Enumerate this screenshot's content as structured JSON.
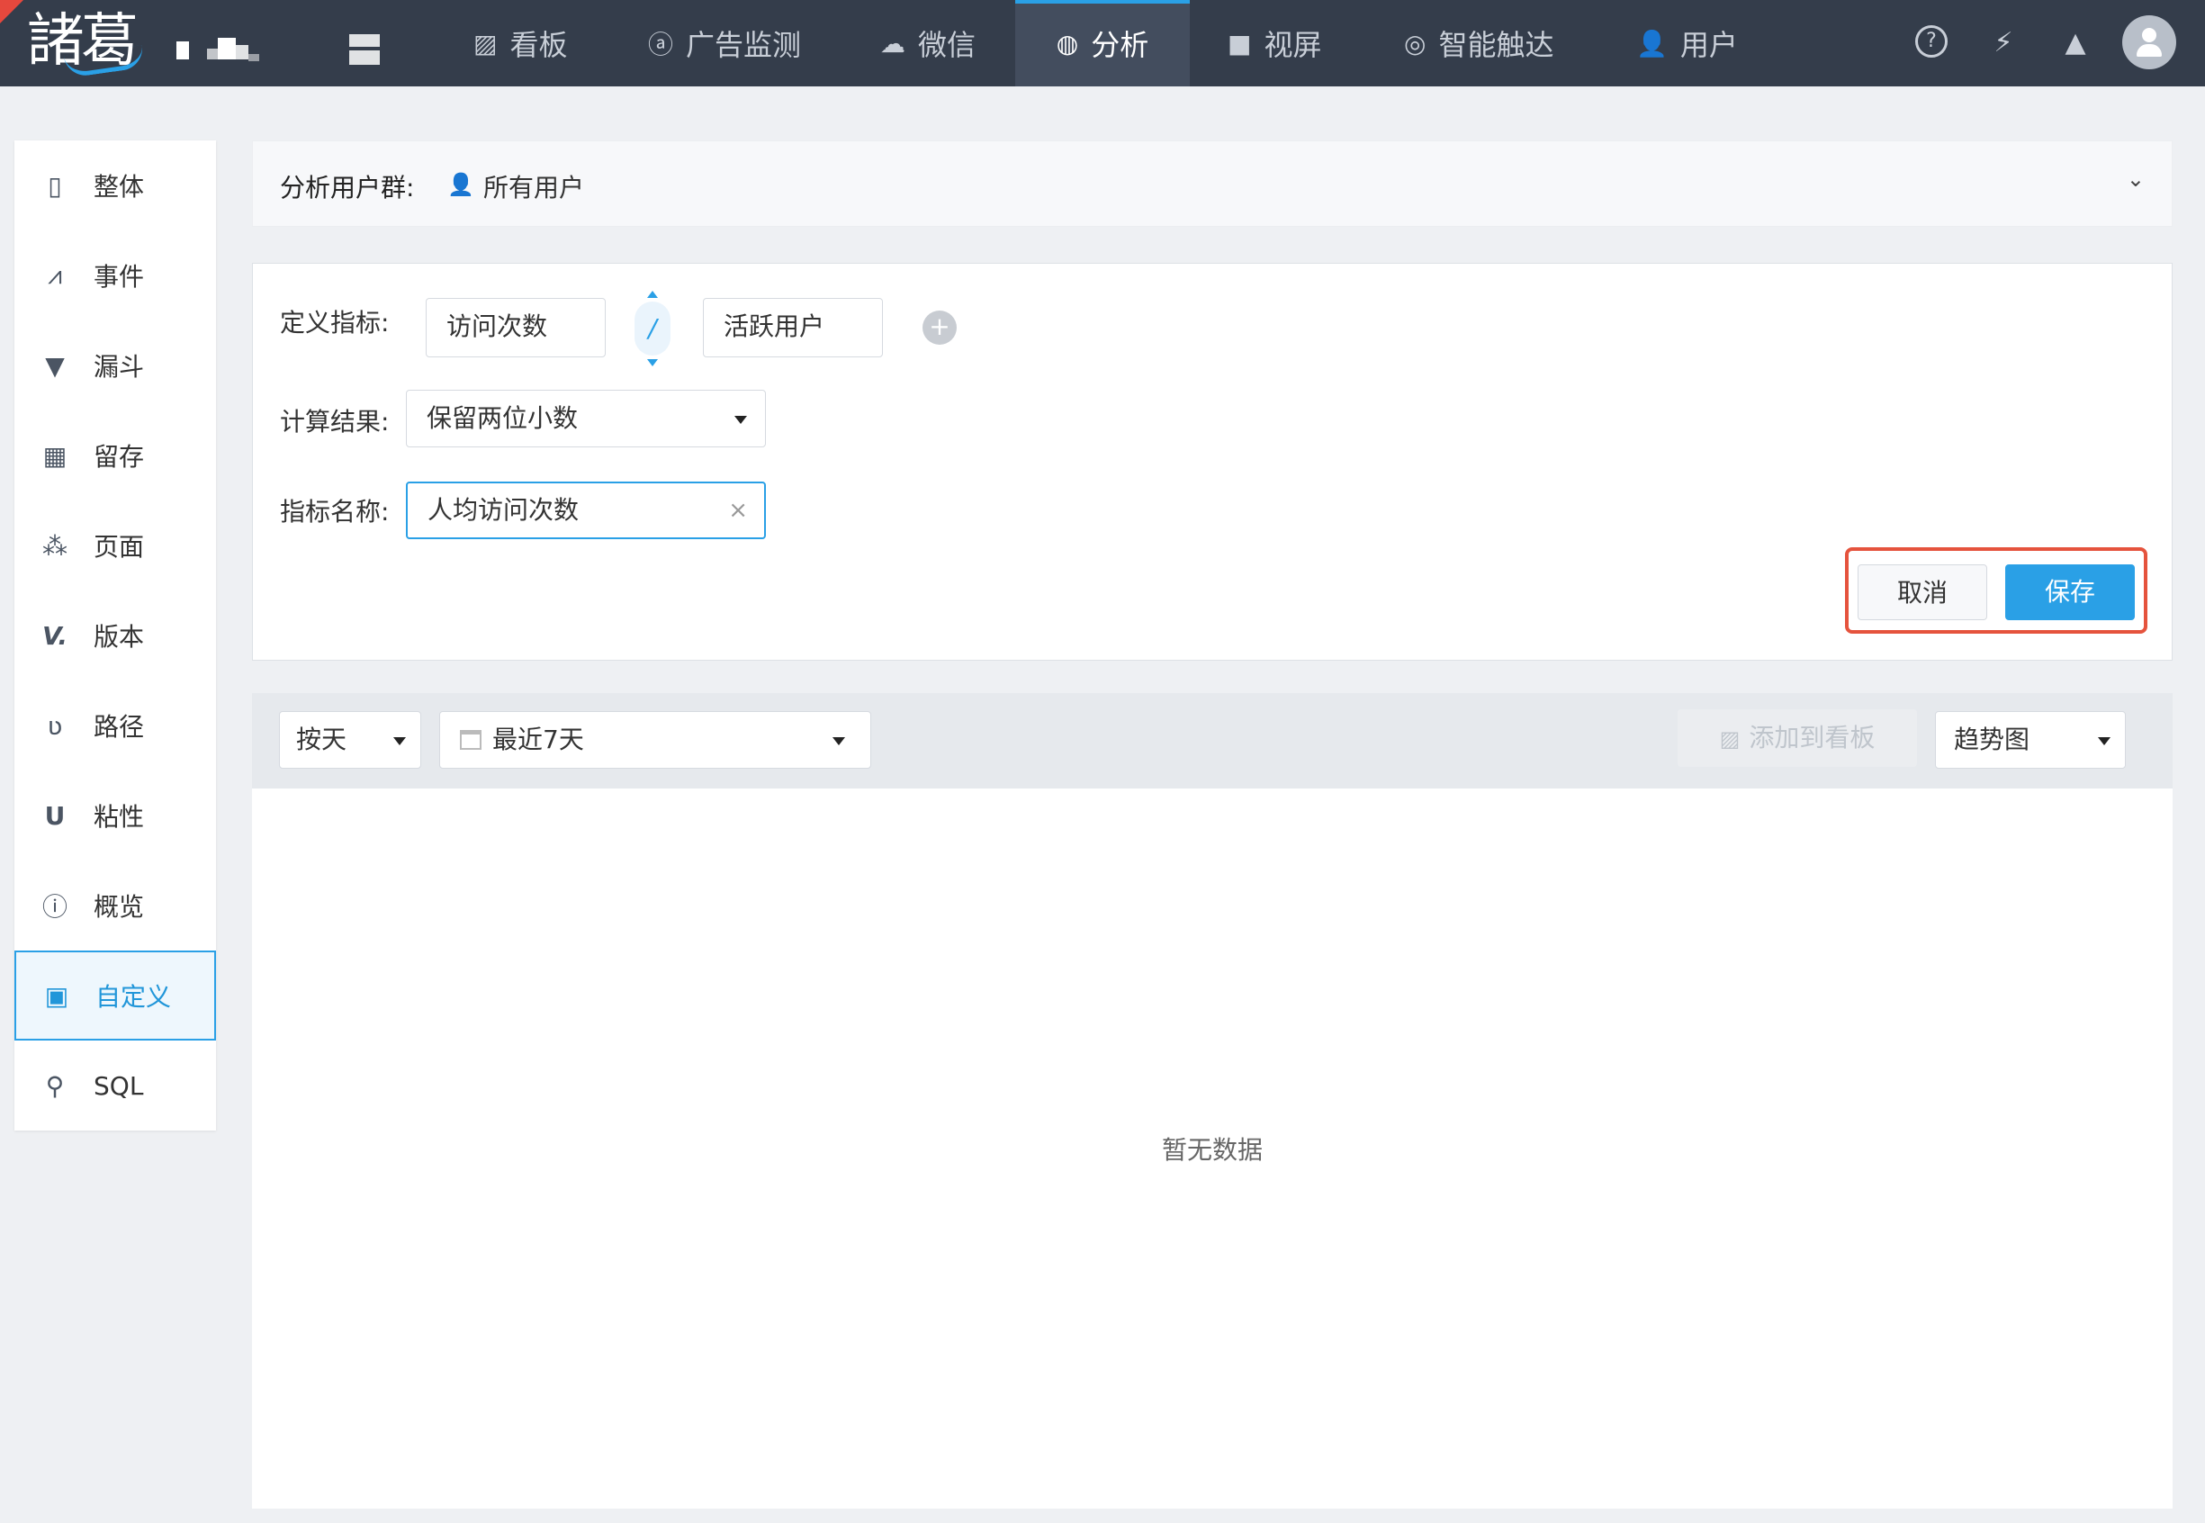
{
  "brand": {
    "logo_text": "諸葛"
  },
  "topnav": [
    {
      "key": "dashboard",
      "icon": "chart-line-icon",
      "label": "看板"
    },
    {
      "key": "ad",
      "icon": "ad-icon",
      "label": "广告监测"
    },
    {
      "key": "wechat",
      "icon": "wechat-icon",
      "label": "微信"
    },
    {
      "key": "analysis",
      "icon": "analysis-icon",
      "label": "分析",
      "active": true
    },
    {
      "key": "screen",
      "icon": "video-icon",
      "label": "视屏"
    },
    {
      "key": "reach",
      "icon": "target-icon",
      "label": "智能触达"
    },
    {
      "key": "users",
      "icon": "user-icon",
      "label": "用户"
    }
  ],
  "topright": {
    "help_glyph": "?",
    "plug_glyph": "⚡",
    "alarm_glyph": "▲"
  },
  "sidebar": [
    {
      "key": "overall",
      "icon": "tablet-icon",
      "glyph": "▯",
      "label": "整体"
    },
    {
      "key": "event",
      "icon": "line-chart-icon",
      "glyph": "⩘",
      "label": "事件"
    },
    {
      "key": "funnel",
      "icon": "funnel-icon",
      "glyph": "▼",
      "label": "漏斗"
    },
    {
      "key": "retention",
      "icon": "grid-icon",
      "glyph": "▦",
      "label": "留存"
    },
    {
      "key": "page",
      "icon": "scatter-icon",
      "glyph": "⁂",
      "label": "页面"
    },
    {
      "key": "version",
      "icon": "version-icon",
      "glyph": "V.",
      "label": "版本"
    },
    {
      "key": "path",
      "icon": "path-icon",
      "glyph": "ʋ",
      "label": "路径"
    },
    {
      "key": "sticky",
      "icon": "magnet-icon",
      "glyph": "U",
      "label": "粘性"
    },
    {
      "key": "overview",
      "icon": "info-circle-icon",
      "glyph": "ⓘ",
      "label": "概览"
    },
    {
      "key": "custom",
      "icon": "inbox-icon",
      "glyph": "▣",
      "label": "自定义",
      "active": true
    },
    {
      "key": "sql",
      "icon": "search-icon",
      "glyph": "⚲",
      "label": "SQL"
    }
  ],
  "usergroup": {
    "label": "分析用户群:",
    "value": "所有用户",
    "chevron": "⌄"
  },
  "define": {
    "metric_label": "定义指标:",
    "numerator": "访问次数",
    "operator": "/",
    "denominator": "活跃用户",
    "add_glyph": "+",
    "result_label": "计算结果:",
    "result_value": "保留两位小数",
    "name_label": "指标名称:",
    "name_value": "人均访问次数",
    "clear_glyph": "×",
    "cancel": "取消",
    "save": "保存"
  },
  "toolbar": {
    "granularity": "按天",
    "date_range": "最近7天",
    "add_to_board": "添加到看板",
    "chart_type": "趋势图"
  },
  "result": {
    "empty_text": "暂无数据"
  },
  "colors": {
    "topbar": "#343d4b",
    "accent": "#2aa0e6",
    "highlight": "#e5533d"
  }
}
